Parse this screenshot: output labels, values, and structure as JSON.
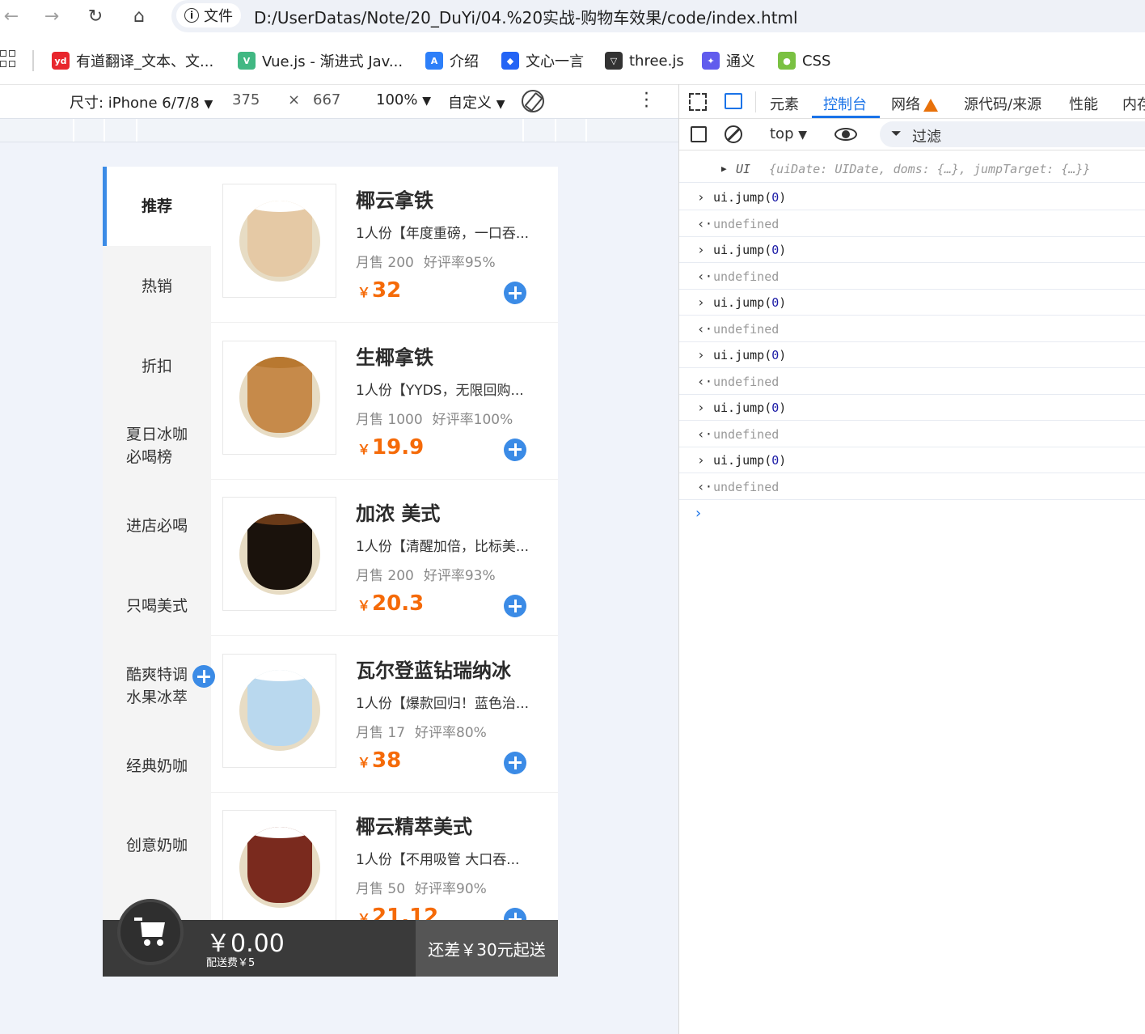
{
  "browser": {
    "file_chip": "文件",
    "url": "D:/UserDatas/Note/20_DuYi/04.%20实战-购物车效果/code/index.html",
    "bookmarks": [
      {
        "label": "有道翻译_文本、文...",
        "icon": "youdao-icon",
        "color": "#e8262d",
        "badge": "yd"
      },
      {
        "label": "Vue.js - 渐进式 Jav...",
        "icon": "vue-icon",
        "color": "#41b883",
        "badge": "V"
      },
      {
        "label": "介绍",
        "icon": "docs-icon",
        "color": "#2d7ff9",
        "badge": "A"
      },
      {
        "label": "文心一言",
        "icon": "wenxin-icon",
        "color": "#2464f5",
        "badge": "◆"
      },
      {
        "label": "three.js",
        "icon": "threejs-icon",
        "color": "#333333",
        "badge": "▽"
      },
      {
        "label": "通义",
        "icon": "tongyi-icon",
        "color": "#615ced",
        "badge": "✦"
      },
      {
        "label": "CSS",
        "icon": "css-icon",
        "color": "#7ac142",
        "badge": "●"
      }
    ]
  },
  "device_toolbar": {
    "dimensions_label": "尺寸: iPhone 6/7/8",
    "width_value": "375",
    "times": "×",
    "height_value": "667",
    "zoom": "100%",
    "throttle": "自定义"
  },
  "devtools": {
    "tabs": [
      "元素",
      "控制台",
      "网络",
      "源代码/来源",
      "性能",
      "内存"
    ],
    "active_tab": "控制台",
    "context": "top",
    "filter_placeholder": "过滤",
    "object_line": {
      "name": "UI",
      "body": "{uiDate: UIDate, doms: {…}, jumpTarget: {…}}"
    },
    "entries": [
      {
        "type": "input",
        "fn": "ui.jump",
        "arg": "0"
      },
      {
        "type": "output",
        "text": "undefined"
      },
      {
        "type": "input",
        "fn": "ui.jump",
        "arg": "0"
      },
      {
        "type": "output",
        "text": "undefined"
      },
      {
        "type": "input",
        "fn": "ui.jump",
        "arg": "0"
      },
      {
        "type": "output",
        "text": "undefined"
      },
      {
        "type": "input",
        "fn": "ui.jump",
        "arg": "0"
      },
      {
        "type": "output",
        "text": "undefined"
      },
      {
        "type": "input",
        "fn": "ui.jump",
        "arg": "0"
      },
      {
        "type": "output",
        "text": "undefined"
      },
      {
        "type": "input",
        "fn": "ui.jump",
        "arg": "0"
      },
      {
        "type": "output",
        "text": "undefined"
      }
    ]
  },
  "app": {
    "categories": [
      "推荐",
      "热销",
      "折扣",
      "夏日冰咖\n必喝榜",
      "进店必喝",
      "只喝美式",
      "酷爽特调\n水果冰萃",
      "经典奶咖",
      "创意奶咖"
    ],
    "active_category": 0,
    "goods": [
      {
        "title": "椰云拿铁",
        "desc": "1人份【年度重磅，一口吞...",
        "sales": "月售 200",
        "rating": "好评率95%",
        "yen": "￥",
        "price": "32",
        "cup": "#e5c9a5",
        "top": "#ffffff"
      },
      {
        "title": "生椰拿铁",
        "desc": "1人份【YYDS，无限回购...",
        "sales": "月售 1000",
        "rating": "好评率100%",
        "yen": "￥",
        "price": "19.9",
        "cup": "#c68a4a",
        "top": "#b87830"
      },
      {
        "title": "加浓 美式",
        "desc": "1人份【清醒加倍，比标美...",
        "sales": "月售 200",
        "rating": "好评率93%",
        "yen": "￥",
        "price": "20.3",
        "cup": "#1a120c",
        "top": "#6a3a18"
      },
      {
        "title": "瓦尔登蓝钻瑞纳冰",
        "desc": "1人份【爆款回归！蓝色治...",
        "sales": "月售 17",
        "rating": "好评率80%",
        "yen": "￥",
        "price": "38",
        "cup": "#b9d8ee",
        "top": "#ffffff"
      },
      {
        "title": "椰云精萃美式",
        "desc": "1人份【不用吸管 大口吞...",
        "sales": "月售 50",
        "rating": "好评率90%",
        "yen": "￥",
        "price": "21.12",
        "cup": "#7a2a1e",
        "top": "#ffffff"
      }
    ],
    "cart": {
      "total": "￥0.00",
      "delivery": "配送费￥5",
      "checkout": "还差￥30元起送"
    }
  }
}
